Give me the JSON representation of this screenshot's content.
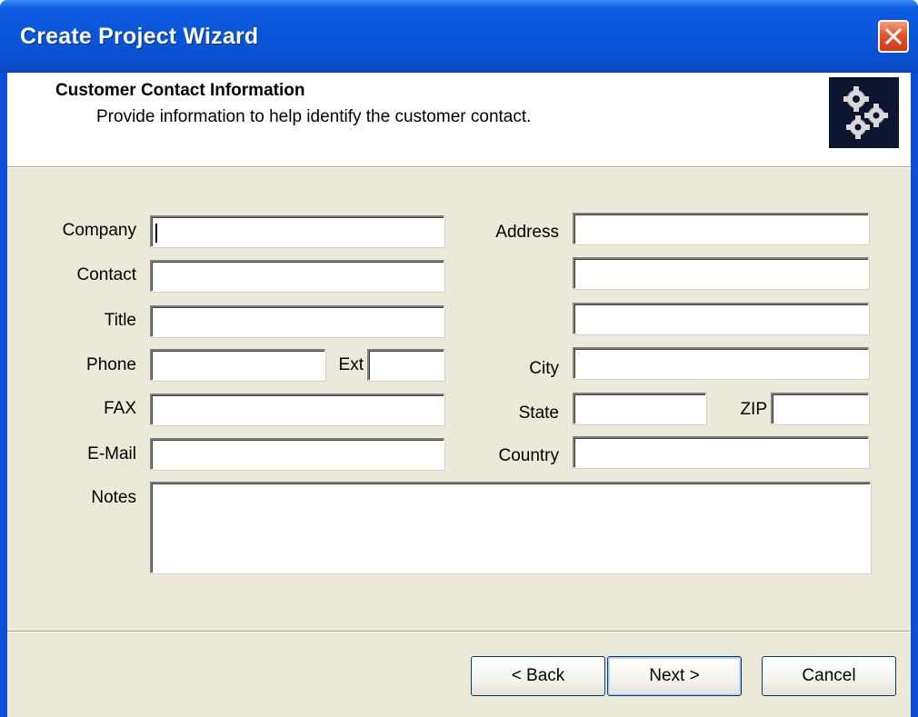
{
  "window": {
    "title": "Create Project Wizard",
    "close_label": "Close"
  },
  "header": {
    "title": "Customer Contact Information",
    "subtitle": "Provide information to help identify the customer contact.",
    "icon": "gears-icon"
  },
  "labels": {
    "company": "Company",
    "contact": "Contact",
    "title": "Title",
    "phone": "Phone",
    "ext": "Ext",
    "fax": "FAX",
    "email": "E-Mail",
    "notes": "Notes",
    "address": "Address",
    "city": "City",
    "state": "State",
    "zip": "ZIP",
    "country": "Country"
  },
  "values": {
    "company": "",
    "contact": "",
    "title": "",
    "phone": "",
    "ext": "",
    "fax": "",
    "email": "",
    "notes": "",
    "address1": "",
    "address2": "",
    "address3": "",
    "city": "",
    "state": "",
    "zip": "",
    "country": ""
  },
  "buttons": {
    "back": "< Back",
    "next": "Next >",
    "cancel": "Cancel"
  },
  "colors": {
    "titlebar": "#0a55d7",
    "dialog_bg": "#ece9d8",
    "close": "#e2552e"
  }
}
